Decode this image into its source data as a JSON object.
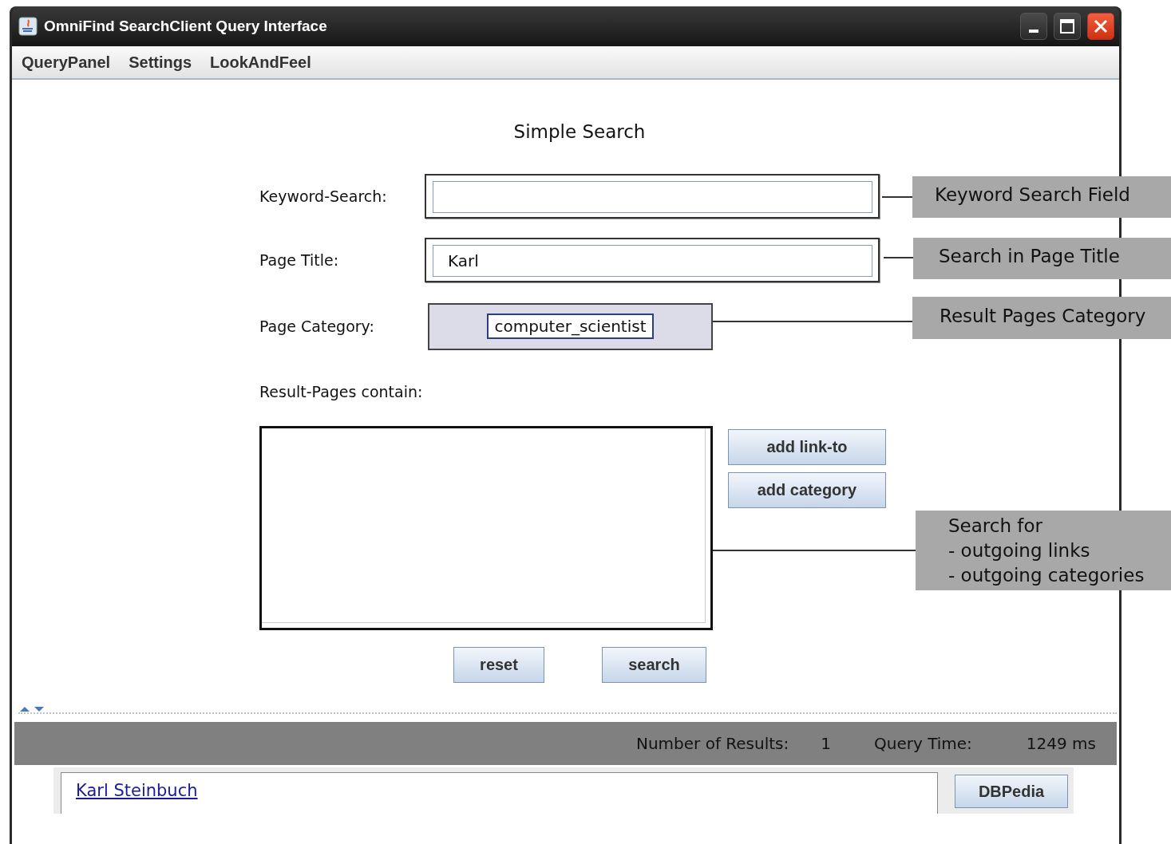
{
  "window": {
    "title": "OmniFind SearchClient Query Interface"
  },
  "menu": [
    "QueryPanel",
    "Settings",
    "LookAndFeel"
  ],
  "form": {
    "heading": "Simple Search",
    "fields": [
      {
        "label": "Keyword-Search:",
        "kind": "text"
      },
      {
        "label": "Page Title:",
        "kind": "text",
        "value": "Karl"
      },
      {
        "label": "Page Category:",
        "kind": "chip",
        "value": "computer_scientist"
      }
    ],
    "contains_label": "Result-Pages contain:",
    "side_buttons": [
      "add link-to",
      "add category"
    ],
    "buttons": [
      "reset",
      "search"
    ]
  },
  "status_bar": {
    "results_label": "Number of Results:",
    "results": "1",
    "time_label": "Query Time:",
    "time": "1249 ms"
  },
  "results": [
    {
      "title": "Karl Steinbuch",
      "source": "DBPedia"
    }
  ],
  "callouts": [
    {
      "lines": [
        "Keyword Search Field"
      ]
    },
    {
      "lines": [
        "Search in Page Title"
      ]
    },
    {
      "lines": [
        "Result Pages Category"
      ]
    },
    {
      "lines": [
        "Search for",
        "- outgoing links",
        "- outgoing categories"
      ]
    }
  ]
}
